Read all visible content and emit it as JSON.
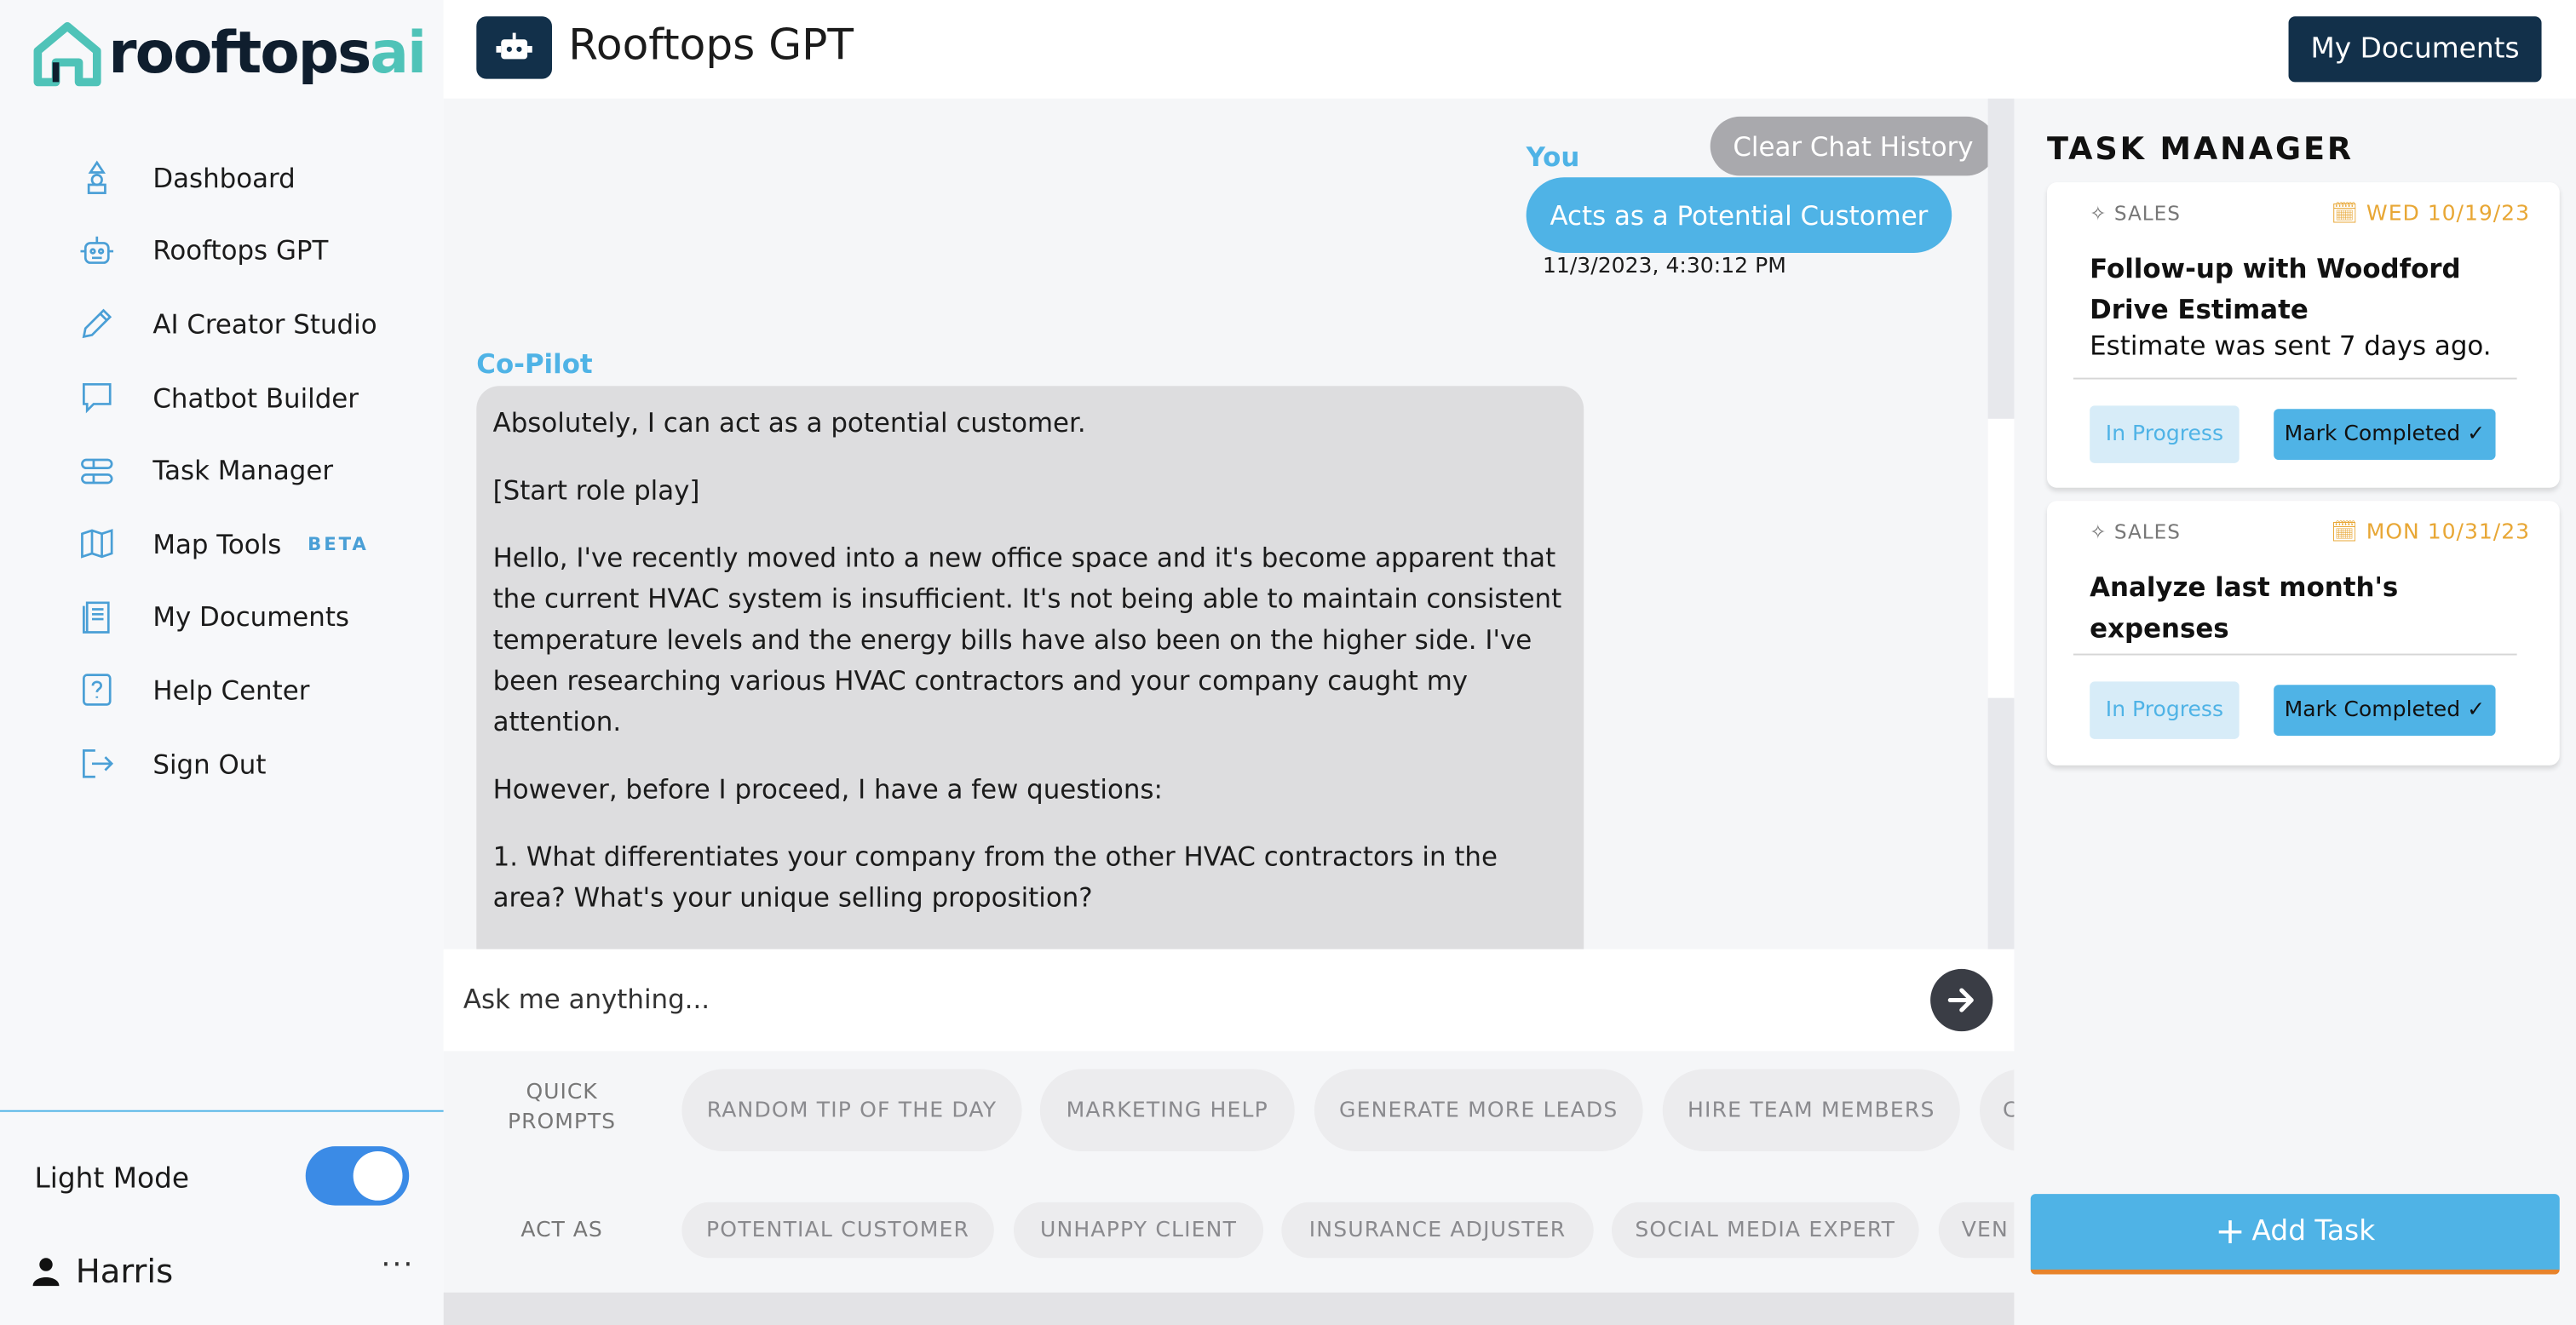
{
  "brand": {
    "name_main": "rooftops",
    "name_accent": "ai"
  },
  "header": {
    "title": "Rooftops GPT",
    "my_documents_label": "My Documents"
  },
  "sidebar": {
    "items": [
      {
        "label": "Dashboard",
        "icon": "shapes-icon"
      },
      {
        "label": "Rooftops GPT",
        "icon": "robot-icon"
      },
      {
        "label": "AI Creator Studio",
        "icon": "pencil-icon"
      },
      {
        "label": "Chatbot Builder",
        "icon": "chat-bubble-icon"
      },
      {
        "label": "Task Manager",
        "icon": "task-list-icon"
      },
      {
        "label": "Map Tools",
        "icon": "map-icon",
        "badge": "BETA"
      },
      {
        "label": "My Documents",
        "icon": "document-icon"
      },
      {
        "label": "Help Center",
        "icon": "help-icon"
      },
      {
        "label": "Sign Out",
        "icon": "sign-out-icon"
      }
    ],
    "light_mode_label": "Light Mode",
    "light_mode_on": true,
    "user_name": "Harris",
    "more_label": "···"
  },
  "chat": {
    "clear_label": "Clear Chat History",
    "user_label": "You",
    "user_message": "Acts as a Potential Customer",
    "user_time": "11/3/2023, 4:30:12 PM",
    "bot_label": "Co-Pilot",
    "bot_paragraphs": [
      "Absolutely, I can act as a potential customer.",
      "[Start role play]",
      "Hello, I've recently moved into a new office space and it's become apparent that the current HVAC system is insufficient. It's not being able to maintain consistent temperature levels and the energy bills have also been on the higher side. I've been researching various HVAC contractors and your company caught my attention.",
      "However, before I proceed, I have a few questions:",
      "1. What differentiates your company from the other HVAC contractors in the area? What's your unique selling proposition?"
    ]
  },
  "input": {
    "placeholder": "Ask me anything..."
  },
  "quick_prompts": {
    "label": "QUICK PROMPTS",
    "chips": [
      "RANDOM TIP OF THE DAY",
      "MARKETING HELP",
      "GENERATE MORE LEADS",
      "HIRE TEAM MEMBERS",
      "C"
    ]
  },
  "act_as": {
    "label": "ACT AS",
    "chips": [
      "POTENTIAL CUSTOMER",
      "UNHAPPY CLIENT",
      "INSURANCE ADJUSTER",
      "SOCIAL MEDIA EXPERT",
      "VEN"
    ]
  },
  "task_manager": {
    "title": "TASK MANAGER",
    "tasks": [
      {
        "category": "SALES",
        "date": "WED 10/19/23",
        "title": "Follow-up with Woodford Drive Estimate",
        "description": "Estimate was sent 7 days ago.",
        "status": "In Progress",
        "action": "Mark Completed"
      },
      {
        "category": "SALES",
        "date": "MON 10/31/23",
        "title": "Analyze last month's expenses",
        "description": "",
        "status": "In Progress",
        "action": "Mark Completed"
      }
    ],
    "add_label": "Add Task"
  },
  "colors": {
    "accent": "#4fb3e6",
    "navy": "#12304a",
    "orange": "#e8a735",
    "teal": "#4fc3b8"
  }
}
